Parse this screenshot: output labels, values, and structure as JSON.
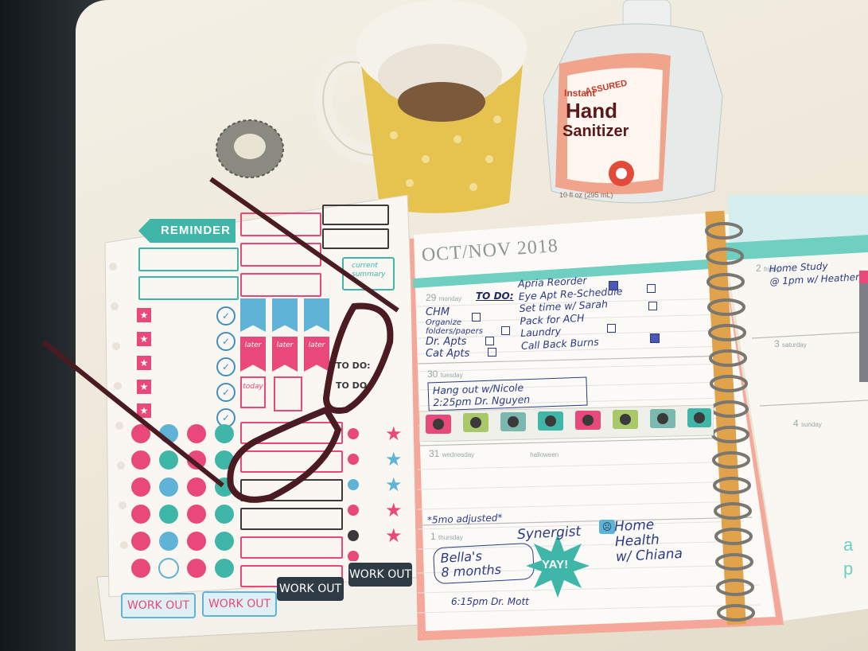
{
  "planner": {
    "header": "OCT/NOV 2018",
    "todo_label": "TO DO:",
    "days": [
      {
        "num": "29",
        "name": "monday"
      },
      {
        "num": "30",
        "name": "tuesday"
      },
      {
        "num": "31",
        "name": "wednesday",
        "extra": "halloween"
      },
      {
        "num": "1",
        "name": "thursday"
      },
      {
        "num": "2",
        "name": "friday"
      },
      {
        "num": "3",
        "name": "saturday"
      },
      {
        "num": "4",
        "name": "sunday"
      }
    ],
    "monday_left": [
      "CHM",
      "Organize folders/papers",
      "Dr. Apts",
      "Cat Apts"
    ],
    "todo_items": [
      "Apria Reorder",
      "Eye Apt Re-Schedule",
      "Set time w/ Sarah",
      "Pack for ACH",
      "Laundry",
      "Call Back Burns"
    ],
    "tuesday_note": [
      "Hang out w/Nicole",
      "2:25pm Dr. Nguyen"
    ],
    "thursday_top": "*5mo adjusted*",
    "bella": [
      "Bella's",
      "8 months"
    ],
    "yay": "YAY!",
    "synergist": "Synergist",
    "home_health": [
      "Home",
      "Health",
      "w/ Chiana"
    ],
    "dr_mott": "6:15pm Dr. Mott",
    "friday_note": [
      "Home Study",
      "@ 1pm w/ Heather"
    ],
    "side_letters": [
      "a",
      "p"
    ]
  },
  "stickers": {
    "reminder": "REMINDER",
    "current_summary": [
      "current",
      "summary"
    ],
    "later": [
      "later",
      "later",
      "later"
    ],
    "today": "today",
    "todo_small": [
      "TO DO:",
      "TO DO:"
    ],
    "workout": [
      "WORK OUT",
      "WORK OUT",
      "WORK OUT",
      "WORK OUT"
    ]
  },
  "sanitizer": {
    "brand": "ASSURED",
    "line1": "Instant",
    "line2": "Hand",
    "line3": "Sanitizer",
    "volume": "10 fl oz (295 mL)"
  },
  "colors": {
    "teal": "#3fb6a8",
    "pink": "#e8497a",
    "mug_yellow": "#e6c34e",
    "glasses": "#4a1c22",
    "ink": "#2c3a86"
  }
}
